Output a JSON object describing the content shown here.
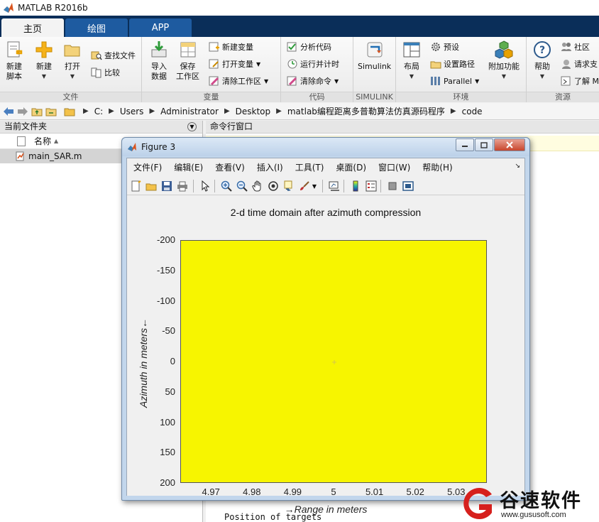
{
  "app": {
    "title": "MATLAB R2016b"
  },
  "ribbon": {
    "tabs": [
      {
        "label": "主页",
        "active": true
      },
      {
        "label": "绘图",
        "active": false
      },
      {
        "label": "APP",
        "active": false
      }
    ],
    "groups": {
      "file": {
        "title": "文件",
        "new_script": "新建\n脚本",
        "new": "新建",
        "open": "打开",
        "find_files": "查找文件",
        "compare": "比较"
      },
      "variable": {
        "title": "变量",
        "import": "导入\n数据",
        "save_ws": "保存\n工作区",
        "new_var": "新建变量",
        "open_var": "打开变量",
        "clear_ws": "清除工作区"
      },
      "code": {
        "title": "代码",
        "analyze": "分析代码",
        "run_time": "运行并计时",
        "clear_cmd": "清除命令"
      },
      "simulink": {
        "title": "SIMULINK",
        "simulink": "Simulink"
      },
      "environment": {
        "title": "环境",
        "layout": "布局",
        "prefs": "预设",
        "set_path": "设置路径",
        "parallel": "Parallel",
        "addons": "附加功能"
      },
      "resources": {
        "title": "资源",
        "help": "帮助",
        "community": "社区",
        "request": "请求支",
        "learn": "了解 M"
      }
    }
  },
  "address": {
    "path": [
      "C:",
      "Users",
      "Administrator",
      "Desktop",
      "matlab编程距离多普勒算法仿真源码程序",
      "code"
    ]
  },
  "left_panel": {
    "header": "当前文件夹",
    "column_name": "名称",
    "files": [
      "main_SAR.m"
    ]
  },
  "command_window": {
    "header": "命令行窗口",
    "last_line": "Position of targets"
  },
  "figure": {
    "window_title": "Figure 3",
    "menu": [
      "文件(F)",
      "编辑(E)",
      "查看(V)",
      "插入(I)",
      "工具(T)",
      "桌面(D)",
      "窗口(W)",
      "帮助(H)"
    ],
    "chart_data": {
      "type": "heatmap",
      "title": "2-d time domain after azimuth compression",
      "xlabel": "→Range in meters",
      "ylabel": "Azimuth in meters←",
      "x_ticks": [
        "4.97",
        "4.98",
        "4.99",
        "5",
        "5.01",
        "5.02",
        "5.03"
      ],
      "y_ticks": [
        "-200",
        "-150",
        "-100",
        "-50",
        "0",
        "50",
        "100",
        "150",
        "200"
      ],
      "xlim": [
        4.9625,
        5.0375
      ],
      "ylim": [
        -200,
        200
      ],
      "fill_color": "#f7f500",
      "point": {
        "x": 5,
        "y": 0
      }
    }
  },
  "watermark": {
    "text": "谷速软件",
    "url": "www.gususoft.com"
  }
}
